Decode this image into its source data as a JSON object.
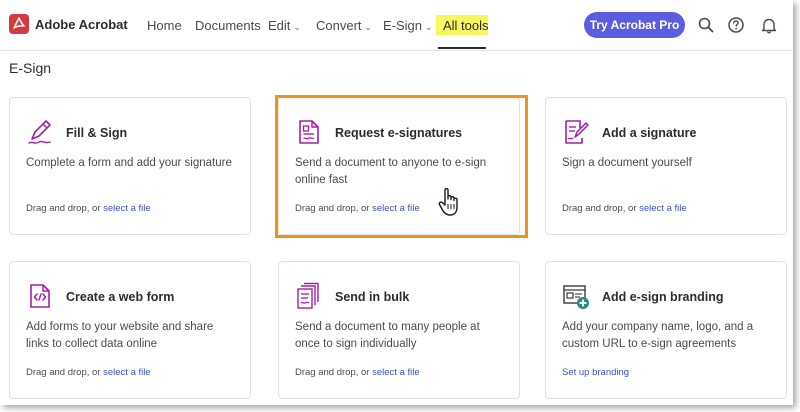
{
  "app": {
    "title": "Adobe Acrobat"
  },
  "nav": {
    "items": [
      {
        "label": "Home",
        "dropdown": false
      },
      {
        "label": "Documents",
        "dropdown": false
      },
      {
        "label": "Edit",
        "dropdown": true
      },
      {
        "label": "Convert",
        "dropdown": true
      },
      {
        "label": "E-Sign",
        "dropdown": true
      },
      {
        "label": "All tools",
        "dropdown": false,
        "active": true
      }
    ],
    "cta_label": "Try Acrobat Pro",
    "icons": [
      "search-icon",
      "help-icon",
      "notifications-icon"
    ]
  },
  "section": {
    "title": "E-Sign"
  },
  "cards": [
    {
      "title": "Fill & Sign",
      "description": "Complete a form and add your signature",
      "footer_text": "Drag and drop, or ",
      "footer_link": "select a file",
      "icon": "fill-sign-icon"
    },
    {
      "title": "Request e-signatures",
      "description": "Send a document to anyone to e-sign online fast",
      "footer_text": "Drag and drop, or ",
      "footer_link": "select a file",
      "icon": "request-esign-icon",
      "highlighted": true
    },
    {
      "title": "Add a signature",
      "description": "Sign a document yourself",
      "footer_text": "Drag and drop, or ",
      "footer_link": "select a file",
      "icon": "add-signature-icon"
    },
    {
      "title": "Create a web form",
      "description": "Add forms to your website and share links to collect data online",
      "footer_text": "Drag and drop, or ",
      "footer_link": "select a file",
      "icon": "web-form-icon"
    },
    {
      "title": "Send in bulk",
      "description": "Send a document to many people at once to sign individually",
      "footer_text": "Drag and drop, or ",
      "footer_link": "select a file",
      "icon": "send-bulk-icon"
    },
    {
      "title": "Add e-sign branding",
      "description": "Add your company name, logo, and a custom URL to e-sign agreements",
      "footer_text": "",
      "footer_link": "Set up branding",
      "icon": "branding-icon"
    }
  ],
  "colors": {
    "accent": "#5c5ce0",
    "icon_purple": "#a51dac",
    "link": "#3a4fc7",
    "highlight_border": "#f0921c",
    "nav_highlight": "#f6f65e",
    "brand_red": "#d7373f"
  }
}
